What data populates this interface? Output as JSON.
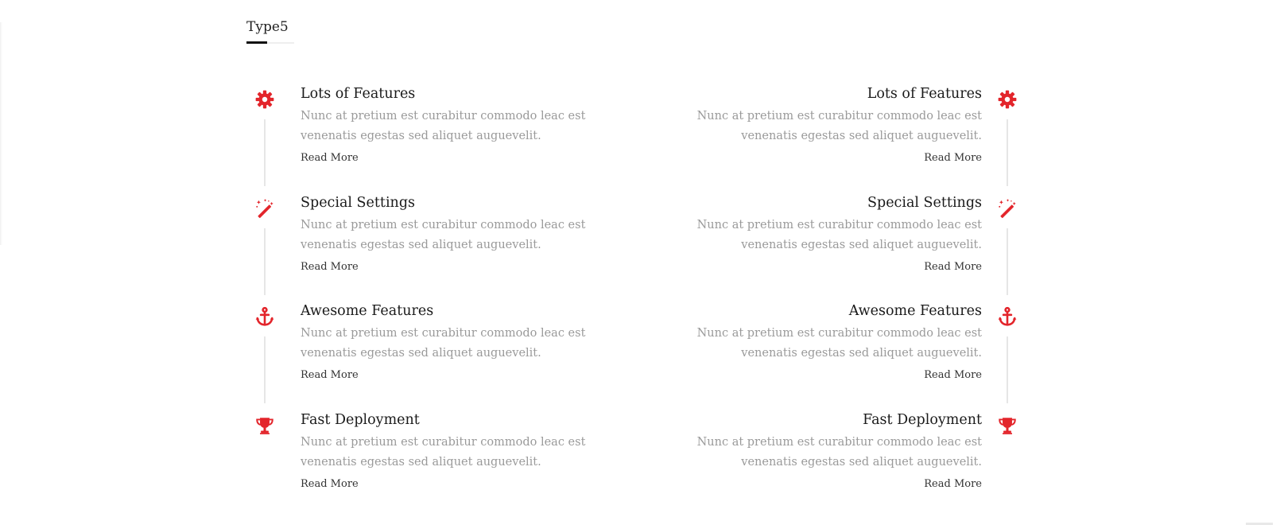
{
  "section": {
    "title": "Type5"
  },
  "colors": {
    "accent": "#e3252b",
    "title_text": "#1a1a1a",
    "body_text": "#9a9a9a",
    "connector": "#e6e6e6"
  },
  "left_column": {
    "items": [
      {
        "icon": "gear-icon",
        "title": "Lots of Features",
        "description": "Nunc at pretium est curabitur commodo leac est venenatis egestas sed aliquet auguevelit.",
        "link": "Read More"
      },
      {
        "icon": "magic-wand-icon",
        "title": "Special Settings",
        "description": "Nunc at pretium est curabitur commodo leac est venenatis egestas sed aliquet auguevelit.",
        "link": "Read More"
      },
      {
        "icon": "anchor-icon",
        "title": "Awesome Features",
        "description": "Nunc at pretium est curabitur commodo leac est venenatis egestas sed aliquet auguevelit.",
        "link": "Read More"
      },
      {
        "icon": "trophy-icon",
        "title": "Fast Deployment",
        "description": "Nunc at pretium est curabitur commodo leac est venenatis egestas sed aliquet auguevelit.",
        "link": "Read More"
      }
    ]
  },
  "right_column": {
    "items": [
      {
        "icon": "gear-icon",
        "title": "Lots of Features",
        "description": "Nunc at pretium est curabitur commodo leac est venenatis egestas sed aliquet auguevelit.",
        "link": "Read More"
      },
      {
        "icon": "magic-wand-icon",
        "title": "Special Settings",
        "description": "Nunc at pretium est curabitur commodo leac est venenatis egestas sed aliquet auguevelit.",
        "link": "Read More"
      },
      {
        "icon": "anchor-icon",
        "title": "Awesome Features",
        "description": "Nunc at pretium est curabitur commodo leac est venenatis egestas sed aliquet auguevelit.",
        "link": "Read More"
      },
      {
        "icon": "trophy-icon",
        "title": "Fast Deployment",
        "description": "Nunc at pretium est curabitur commodo leac est venenatis egestas sed aliquet auguevelit.",
        "link": "Read More"
      }
    ]
  }
}
